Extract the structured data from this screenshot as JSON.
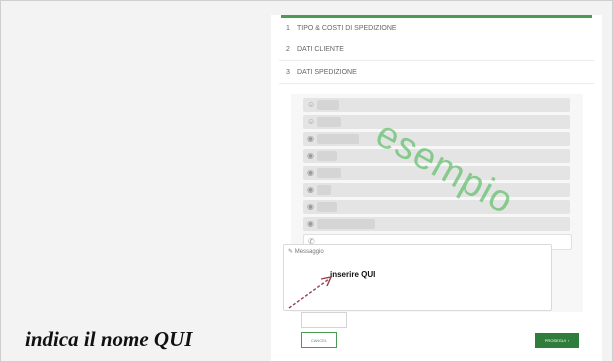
{
  "steps": [
    {
      "num": "1",
      "label": "TIPO & COSTI DI SPEDIZIONE"
    },
    {
      "num": "2",
      "label": "DATI CLIENTE"
    },
    {
      "num": "3",
      "label": "DATI SPEDIZIONE"
    }
  ],
  "form": {
    "fields": [
      {
        "icon": "person-icon",
        "glyph": "☺",
        "fill": 0.1
      },
      {
        "icon": "person-icon",
        "glyph": "☺",
        "fill": 0.11
      },
      {
        "icon": "pin-icon",
        "glyph": "◉",
        "fill": 0.18
      },
      {
        "icon": "pin-icon",
        "glyph": "◉",
        "fill": 0.09
      },
      {
        "icon": "location-icon",
        "glyph": "◉",
        "fill": 0.11
      },
      {
        "icon": "location-icon",
        "glyph": "◉",
        "fill": 0.06
      },
      {
        "icon": "pin-icon",
        "glyph": "◉",
        "fill": 0.08
      },
      {
        "icon": "pin-icon",
        "glyph": "◉",
        "fill": 0.25
      },
      {
        "icon": "phone-icon",
        "glyph": "✆",
        "fill": 0
      }
    ],
    "message_placeholder": "Messaggio",
    "message_icon": "edit-icon"
  },
  "buttons": {
    "cancel_label": "CANCEL",
    "next_label": "PROSEGUI",
    "next_icon": "chevron-right-icon"
  },
  "annotations": {
    "insert_label": "inserire  QUI",
    "watermark": "esempio",
    "caption": "indica il nome QUI"
  },
  "colors": {
    "accent": "#4d9a55",
    "button_primary": "#2f7d3a",
    "watermark": "#4bb955",
    "arrow": "#9a3b4b"
  }
}
